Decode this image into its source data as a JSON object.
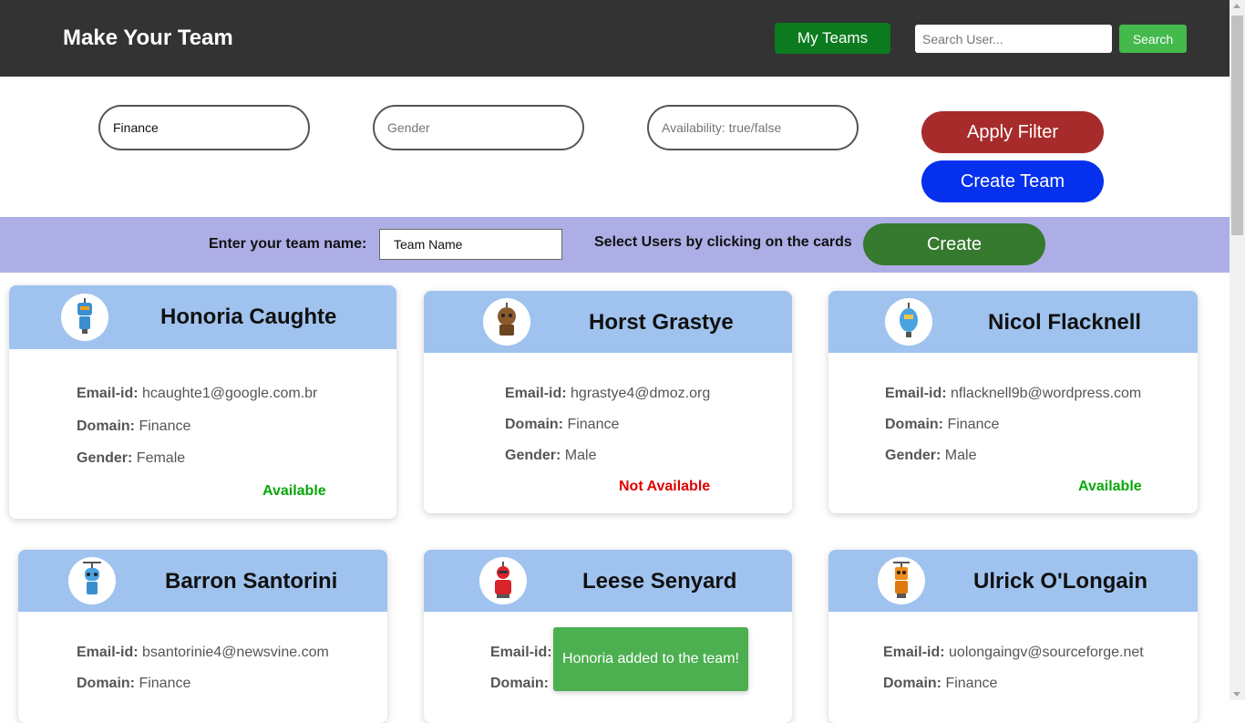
{
  "header": {
    "brand": "Make Your Team",
    "my_teams_label": "My Teams",
    "search_placeholder": "Search User...",
    "search_label": "Search"
  },
  "filters": {
    "domain_value": "Finance",
    "gender_placeholder": "Gender",
    "availability_placeholder": "Availability: true/false",
    "apply_label": "Apply Filter",
    "create_team_label": "Create Team"
  },
  "team_bar": {
    "name_label": "Enter your team name:",
    "name_value": "Team Name",
    "hint": "Select Users by clicking on the cards",
    "create_label": "Create"
  },
  "labels": {
    "email": "Email-id:",
    "domain": "Domain:",
    "gender": "Gender:"
  },
  "users": [
    {
      "name": "Honoria Caughte",
      "email": "hcaughte1@google.com.br",
      "domain": "Finance",
      "gender": "Female",
      "status": "Available",
      "avatar": "robot-blue-icon"
    },
    {
      "name": "Horst Grastye",
      "email": "hgrastye4@dmoz.org",
      "domain": "Finance",
      "gender": "Male",
      "status": "Not Available",
      "avatar": "robot-brown-icon"
    },
    {
      "name": "Nicol Flacknell",
      "email": "nflacknell9b@wordpress.com",
      "domain": "Finance",
      "gender": "Male",
      "status": "Available",
      "avatar": "robot-lightblue-icon"
    },
    {
      "name": "Barron Santorini",
      "email": "bsantorinie4@newsvine.com",
      "domain": "Finance",
      "avatar": "robot-propeller-blue-icon"
    },
    {
      "name": "Leese Senyard",
      "email": "",
      "domain": "",
      "avatar": "robot-red-icon"
    },
    {
      "name": "Ulrick O'Longain",
      "email": "uolongaingv@sourceforge.net",
      "domain": "Finance",
      "avatar": "robot-orange-icon"
    }
  ],
  "colors": {
    "available": "#0aa60a",
    "not_available": "#e00000",
    "card_header": "#9fc3ee",
    "header_bg": "#333333"
  },
  "toast": {
    "message": "Honoria added to the team!"
  }
}
